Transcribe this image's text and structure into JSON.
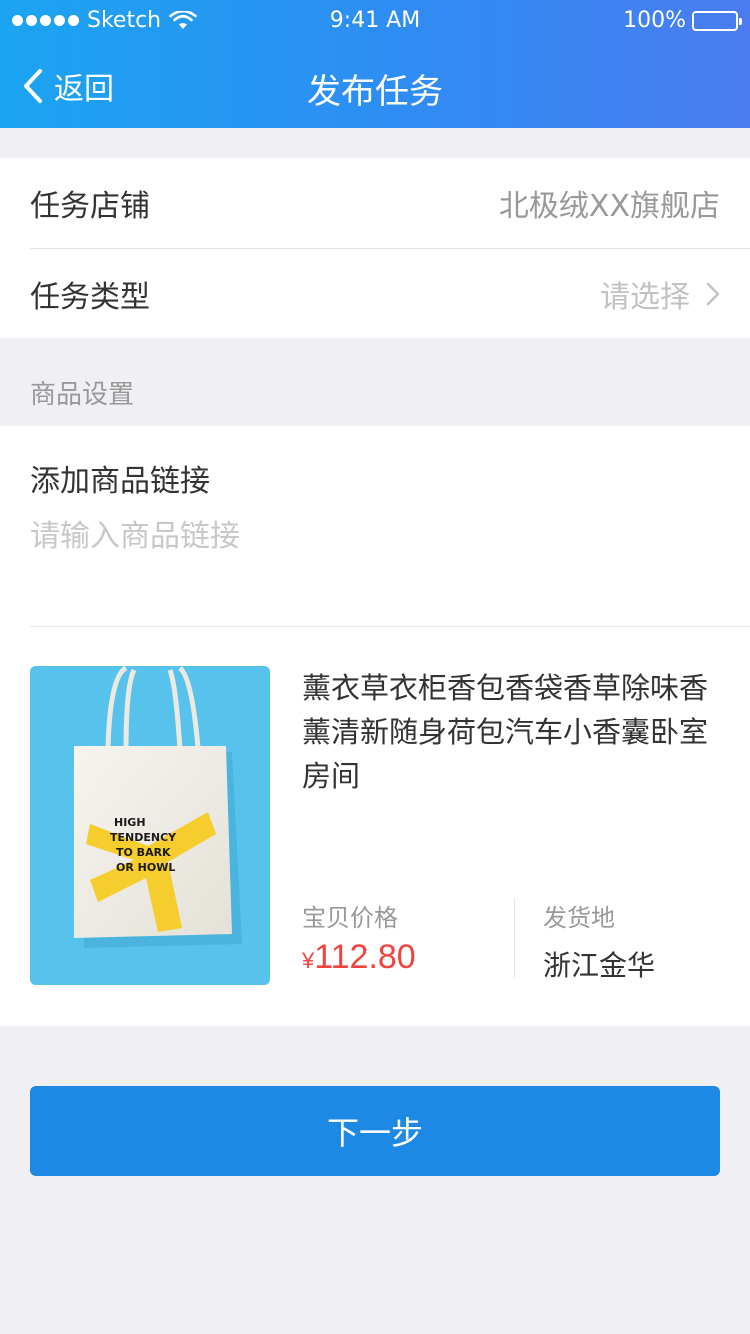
{
  "status_bar": {
    "carrier": "Sketch",
    "time": "9:41 AM",
    "battery": "100%"
  },
  "nav": {
    "back_label": "返回",
    "title": "发布任务"
  },
  "form": {
    "shop": {
      "label": "任务店铺",
      "value": "北极绒XX旗舰店"
    },
    "type": {
      "label": "任务类型",
      "value": "请选择"
    }
  },
  "section": {
    "title": "商品设置"
  },
  "link": {
    "label": "添加商品链接",
    "placeholder": "请输入商品链接"
  },
  "product": {
    "title": "薰衣草衣柜香包香袋香草除味香薰清新随身荷包汽车小香囊卧室房间",
    "image_text": [
      "HIGH",
      "TENDENCY",
      "TO BARK",
      "OR HOWL"
    ],
    "price_label": "宝贝价格",
    "price_symbol": "¥",
    "price": "112.80",
    "ship_label": "发货地",
    "ship_from": "浙江金华"
  },
  "next_button": "下一步",
  "colors": {
    "header_start": "#1ba4f2",
    "header_end": "#4a7cf0",
    "primary_button": "#1e88e5",
    "price": "#f2443f",
    "page_bg": "#efeff4"
  }
}
